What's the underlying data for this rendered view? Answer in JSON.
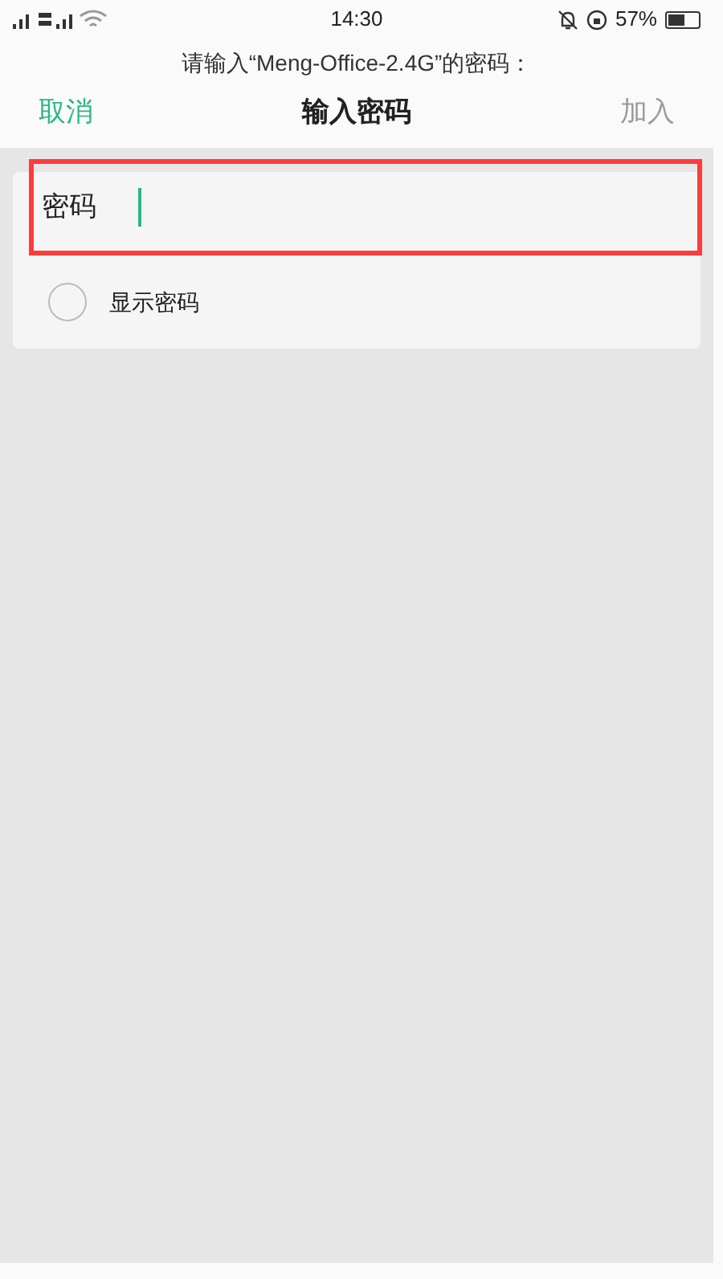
{
  "status_bar": {
    "time": "14:30",
    "battery": "57%"
  },
  "header": {
    "prompt": "请输入“Meng-Office-2.4G”的密码：",
    "title": "输入密码",
    "cancel": "取消",
    "join": {
      "label": "加入",
      "disabled": true
    }
  },
  "password_field": {
    "label": "密码",
    "highlighted": true
  },
  "show_password": {
    "label": "显示密码",
    "checked": false
  }
}
